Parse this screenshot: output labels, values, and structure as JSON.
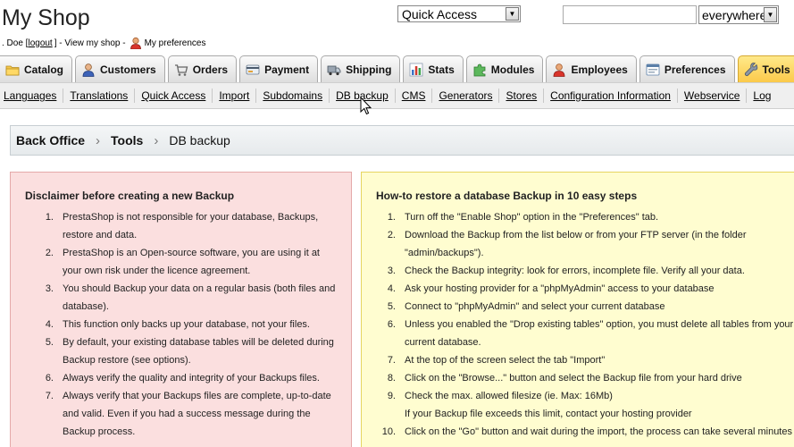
{
  "header": {
    "shop_name": "My Shop",
    "user_prefix": ". Doe [",
    "logout_label": "logout",
    "user_mid": "] - View my shop -",
    "preferences_label": "My preferences",
    "quick_access_value": "Quick Access",
    "search_value": "",
    "search_scope_value": "everywhere"
  },
  "tabs": [
    {
      "label": "Catalog",
      "icon": "folder-icon"
    },
    {
      "label": "Customers",
      "icon": "customer-icon"
    },
    {
      "label": "Orders",
      "icon": "cart-icon"
    },
    {
      "label": "Payment",
      "icon": "payment-icon"
    },
    {
      "label": "Shipping",
      "icon": "truck-icon"
    },
    {
      "label": "Stats",
      "icon": "stats-icon"
    },
    {
      "label": "Modules",
      "icon": "puzzle-icon"
    },
    {
      "label": "Employees",
      "icon": "employee-icon"
    },
    {
      "label": "Preferences",
      "icon": "preferences-icon"
    },
    {
      "label": "Tools",
      "icon": "wrench-icon",
      "active": true
    }
  ],
  "subnav": [
    "Languages",
    "Translations",
    "Quick Access",
    "Import",
    "Subdomains",
    "DB backup",
    "CMS",
    "Generators",
    "Stores",
    "Configuration Information",
    "Webservice",
    "Log"
  ],
  "breadcrumb": [
    "Back Office",
    "Tools",
    "DB backup"
  ],
  "disclaimer": {
    "title": "Disclaimer before creating a new Backup",
    "items": [
      "PrestaShop is not responsible for your database, Backups, restore and data.",
      "PrestaShop is an Open-source software, you are using it at your own risk under the licence agreement.",
      "You should Backup your data on a regular basis (both files and database).",
      "This function only backs up your database, not your files.",
      "By default, your existing database tables will be deleted during Backup restore (see options).",
      "Always verify the quality and integrity of your Backups files.",
      "Always verify that your Backups files are complete, up-to-date and valid. Even if you had a success message during the Backup process."
    ]
  },
  "howto": {
    "title": "How-to restore a database Backup in 10 easy steps",
    "items": [
      {
        "n": "1.",
        "lines": [
          "Turn off the \"Enable Shop\" option in the \"Preferences\" tab."
        ]
      },
      {
        "n": "2.",
        "lines": [
          "Download the Backup from the list below or from your FTP server (in the folder",
          "\"admin/backups\")."
        ]
      },
      {
        "n": "3.",
        "lines": [
          "Check the Backup integrity: look for errors, incomplete file. Verify all your data."
        ]
      },
      {
        "n": "4.",
        "lines": [
          "Ask your hosting provider for a \"phpMyAdmin\" access to your database"
        ]
      },
      {
        "n": "5.",
        "lines": [
          "Connect to \"phpMyAdmin\" and select your current database"
        ]
      },
      {
        "n": "6.",
        "lines": [
          "Unless you enabled the \"Drop existing tables\" option, you must delete all tables from your",
          "current database."
        ]
      },
      {
        "n": "7.",
        "lines": [
          "At the top of the screen select the tab \"Import\""
        ]
      },
      {
        "n": "8.",
        "lines": [
          "Click on the \"Browse...\" button and select the Backup file from your hard drive"
        ]
      },
      {
        "n": "9.",
        "lines": [
          "Check the max. allowed filesize (ie. Max: 16Mb)",
          "If your Backup file exceeds this limit, contact your hosting provider"
        ]
      },
      {
        "n": "10.",
        "lines": [
          "Click on the \"Go\" button and wait during the import, the process can take several minutes"
        ]
      }
    ]
  }
}
